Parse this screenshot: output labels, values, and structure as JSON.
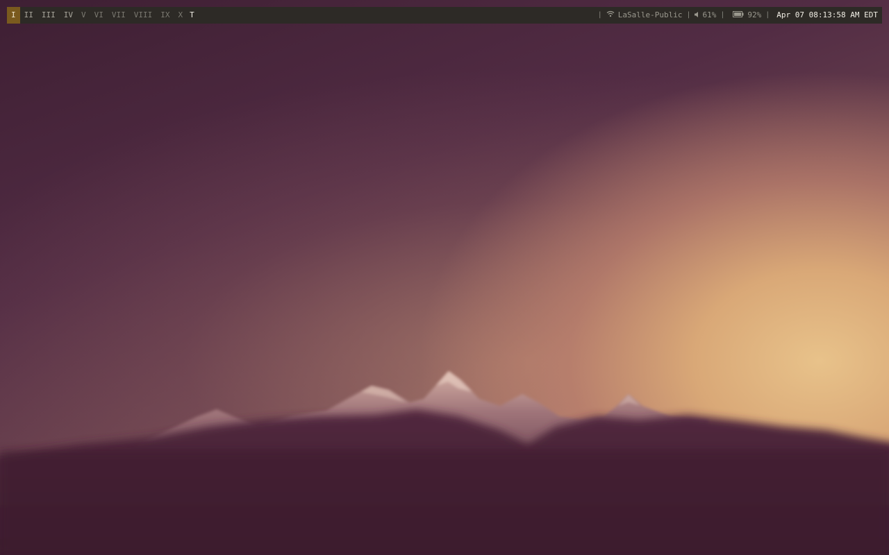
{
  "bar": {
    "workspaces": [
      {
        "label": "I",
        "state": "active"
      },
      {
        "label": "II",
        "state": "populated"
      },
      {
        "label": "III",
        "state": "populated"
      },
      {
        "label": "IV",
        "state": "populated"
      },
      {
        "label": "V",
        "state": "empty"
      },
      {
        "label": "VI",
        "state": "empty"
      },
      {
        "label": "VII",
        "state": "empty"
      },
      {
        "label": "VIII",
        "state": "empty"
      },
      {
        "label": "IX",
        "state": "empty"
      },
      {
        "label": "X",
        "state": "empty"
      }
    ],
    "layout_indicator": "T",
    "separator": "|",
    "wifi": {
      "icon": "wifi-icon",
      "ssid": "LaSalle-Public"
    },
    "volume": {
      "icon": "speaker-icon",
      "level": "61%"
    },
    "battery": {
      "icon": "battery-icon",
      "level": "92%",
      "fill_fraction": 0.92
    },
    "clock": "Apr 07 08:13:58 AM EDT"
  },
  "colors": {
    "bar_background": "#2d2a26",
    "active_workspace": "#7a5a1e",
    "bar_text": "#8a8a82",
    "clock_text": "#f2efe6"
  }
}
